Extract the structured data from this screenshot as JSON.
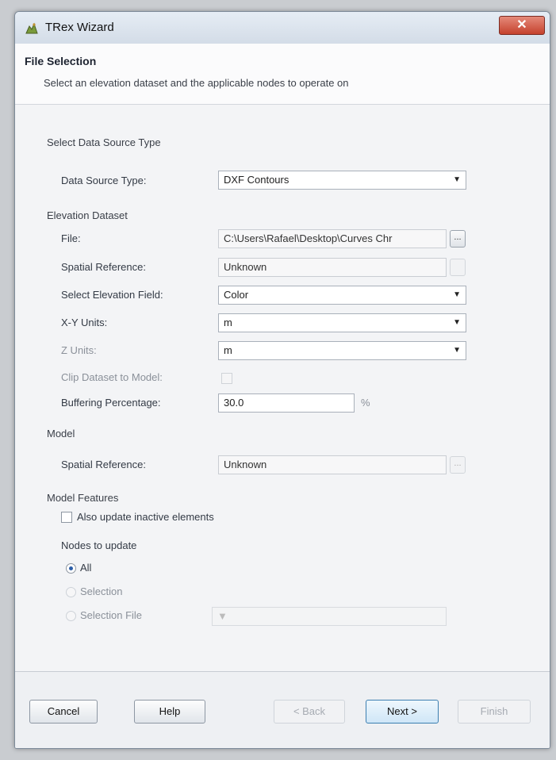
{
  "window": {
    "title": "TRex Wizard",
    "close_glyph": "✕"
  },
  "header": {
    "page_title": "File Selection",
    "description": "Select an elevation dataset and the applicable nodes to operate on"
  },
  "data_source": {
    "group_label": "Select Data Source Type",
    "type_label": "Data Source Type:",
    "type_value": "DXF Contours"
  },
  "elevation": {
    "group_label": "Elevation Dataset",
    "file_label": "File:",
    "file_value": "C:\\Users\\Rafael\\Desktop\\Curves Chr",
    "spatial_ref_label": "Spatial Reference:",
    "spatial_ref_value": "Unknown",
    "elev_field_label": "Select Elevation Field:",
    "elev_field_value": "Color",
    "xy_units_label": "X-Y Units:",
    "xy_units_value": "m",
    "z_units_label": "Z Units:",
    "z_units_value": "m",
    "clip_label": "Clip Dataset to Model:",
    "buffer_label": "Buffering Percentage:",
    "buffer_value": "30.0",
    "buffer_unit": "%"
  },
  "model": {
    "group_label": "Model",
    "spatial_ref_label": "Spatial Reference:",
    "spatial_ref_value": "Unknown"
  },
  "features": {
    "group_label": "Model Features",
    "inactive_label": "Also update inactive elements",
    "nodes_label": "Nodes to update",
    "opt_all": "All",
    "opt_selection": "Selection",
    "opt_selection_file": "Selection File"
  },
  "browse_label": "...",
  "footer": {
    "cancel": "Cancel",
    "help": "Help",
    "back": "< Back",
    "next": "Next >",
    "finish": "Finish"
  }
}
